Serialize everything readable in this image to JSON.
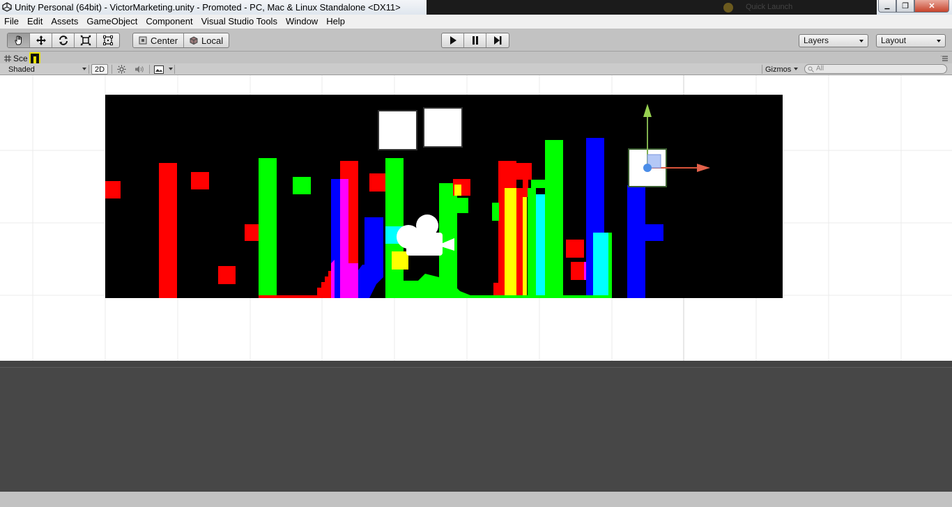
{
  "window": {
    "title": "Unity Personal (64bit) - VictorMarketing.unity - Promoted - PC, Mac & Linux Standalone <DX11>",
    "blurred_text": "Quick Launch",
    "close_glyph": "✕",
    "max_glyph": "❐",
    "min_glyph": "▁"
  },
  "menu": [
    "File",
    "Edit",
    "Assets",
    "GameObject",
    "Component",
    "Visual Studio Tools",
    "Window",
    "Help"
  ],
  "toolbar": {
    "pivot_label": "Center",
    "space_label": "Local",
    "layers_label": "Layers",
    "layout_label": "Layout"
  },
  "scene_tab": {
    "label": "Sce",
    "shading_mode": "Shaded",
    "mode_2d": "2D",
    "gizmos_label": "Gizmos",
    "search_placeholder": "All"
  },
  "colors": {
    "accent_red": "#ff0000",
    "accent_green": "#00ff00",
    "accent_blue": "#0000ff",
    "accent_yellow": "#ffff00",
    "accent_cyan": "#00ffff",
    "accent_magenta": "#ff00ff"
  }
}
